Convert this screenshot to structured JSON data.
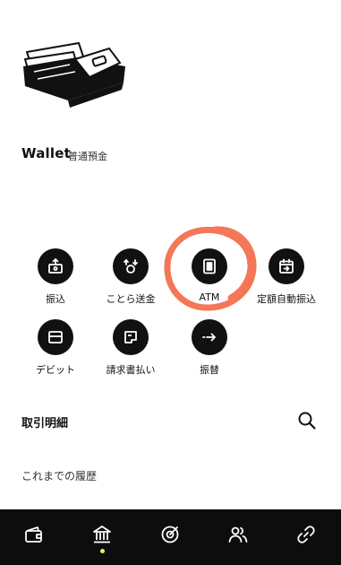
{
  "account": {
    "title": "Wallet",
    "subtitle": "普通預金"
  },
  "actions": [
    {
      "label": "振込",
      "icon": "transfer-money-icon"
    },
    {
      "label": "ことら送金",
      "icon": "kotora-send-icon"
    },
    {
      "label": "ATM",
      "icon": "atm-icon"
    },
    {
      "label": "定額自動振込",
      "icon": "scheduled-transfer-icon"
    },
    {
      "label": "デビット",
      "icon": "debit-card-icon"
    },
    {
      "label": "請求書払い",
      "icon": "bill-payment-icon"
    },
    {
      "label": "振替",
      "icon": "account-transfer-icon"
    }
  ],
  "transactions": {
    "title": "取引明細",
    "history_label": "これまでの履歴"
  },
  "tabbar": {
    "items": [
      "wallet-tab-icon",
      "bank-tab-icon",
      "target-tab-icon",
      "people-tab-icon",
      "link-tab-icon"
    ],
    "active": "bank-tab-icon",
    "indicator_color": "#e9ef56"
  },
  "colors": {
    "icon_bg": "#111111",
    "highlight_annotation": "#f26b4a",
    "tabbar_bg": "#0d0d0d"
  }
}
